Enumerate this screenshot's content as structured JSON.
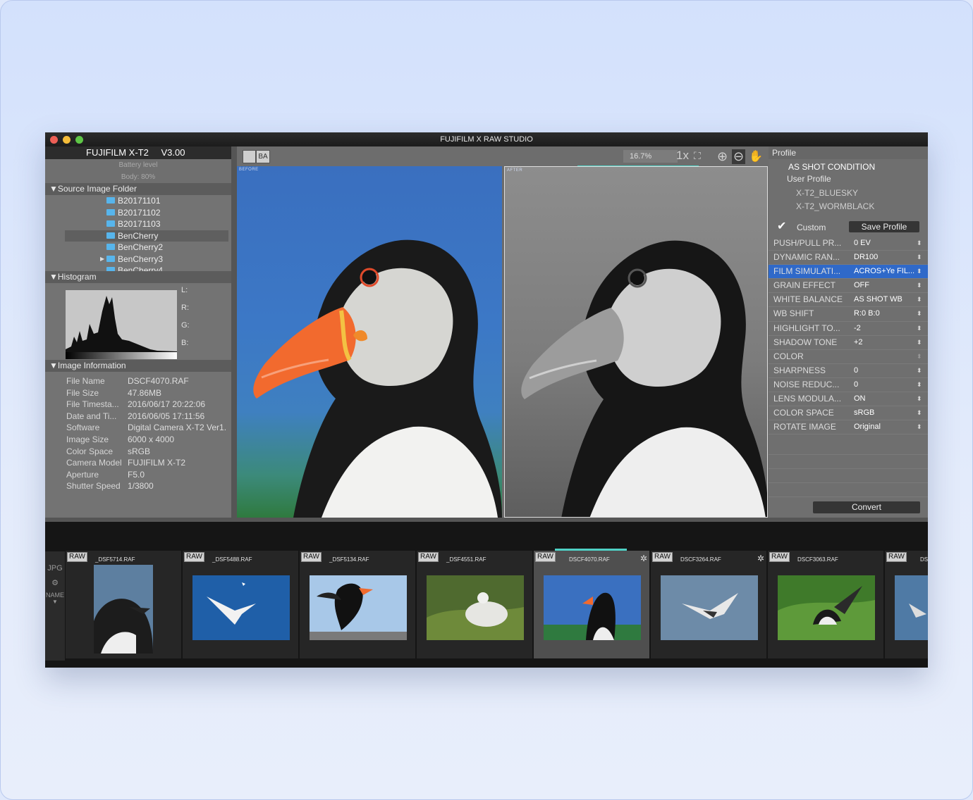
{
  "window": {
    "title": "FUJIFILM X RAW STUDIO"
  },
  "camera": {
    "model": "FUJIFILM X-T2",
    "version": "V3.00",
    "battery_label": "Battery level",
    "battery_value": "Body: 80%"
  },
  "sections": {
    "source": "Source Image Folder",
    "histogram": "Histogram",
    "info": "Image Information"
  },
  "folders": [
    "B20171101",
    "B20171102",
    "B20171103",
    "BenCherry",
    "BenCherry2",
    "BenCherry3",
    "BenCherry4"
  ],
  "histogram": {
    "labels": [
      "L:",
      "R:",
      "G:",
      "B:"
    ]
  },
  "image_info": [
    {
      "k": "File Name",
      "v": "DSCF4070.RAF"
    },
    {
      "k": "File Size",
      "v": "47.86MB"
    },
    {
      "k": "File Timesta...",
      "v": "2016/06/17 20:22:06"
    },
    {
      "k": "Date and Ti...",
      "v": "2016/06/05 17:11:56"
    },
    {
      "k": "Software",
      "v": "Digital Camera X-T2 Ver1."
    },
    {
      "k": "Image Size",
      "v": "6000 x 4000"
    },
    {
      "k": "Color Space",
      "v": "sRGB"
    },
    {
      "k": "Camera Model",
      "v": "FUJIFILM X-T2"
    },
    {
      "k": "Aperture",
      "v": "F5.0"
    },
    {
      "k": "Shutter Speed",
      "v": "1/3800"
    }
  ],
  "toolbar": {
    "zoom": "16.7%",
    "ba_label": "BA",
    "one_x": "1x",
    "before_tag": "BEFORE",
    "after_tag": "AFTER"
  },
  "profile": {
    "header": "Profile",
    "as_shot": "AS SHOT CONDITION",
    "user_profile": "User Profile",
    "items": [
      "X-T2_BLUESKY",
      "X-T2_WORMBLACK"
    ],
    "custom": "Custom",
    "save": "Save Profile",
    "convert": "Convert"
  },
  "params": [
    {
      "k": "PUSH/PULL PR...",
      "v": "0 EV"
    },
    {
      "k": "DYNAMIC RAN...",
      "v": "DR100"
    },
    {
      "k": "FILM SIMULATI...",
      "v": "ACROS+Ye FIL..."
    },
    {
      "k": "GRAIN EFFECT",
      "v": "OFF"
    },
    {
      "k": "WHITE BALANCE",
      "v": "AS SHOT WB"
    },
    {
      "k": "WB SHIFT",
      "v": "R:0 B:0"
    },
    {
      "k": "HIGHLIGHT TO...",
      "v": "-2"
    },
    {
      "k": "SHADOW TONE",
      "v": "+2"
    },
    {
      "k": "COLOR",
      "v": ""
    },
    {
      "k": "SHARPNESS",
      "v": "0"
    },
    {
      "k": "NOISE REDUC...",
      "v": "0"
    },
    {
      "k": "LENS MODULA...",
      "v": "ON"
    },
    {
      "k": "COLOR SPACE",
      "v": "sRGB"
    },
    {
      "k": "ROTATE IMAGE",
      "v": "Original"
    }
  ],
  "filmstrip": {
    "side": [
      "JPG",
      "NAME"
    ],
    "raw_label": "RAW",
    "files": [
      "_DSF5714.RAF",
      "_DSF5488.RAF",
      "_DSF5134.RAF",
      "_DSF4551.RAF",
      "DSCF4070.RAF",
      "DSCF3264.RAF",
      "DSCF3063.RAF",
      "DS"
    ]
  }
}
